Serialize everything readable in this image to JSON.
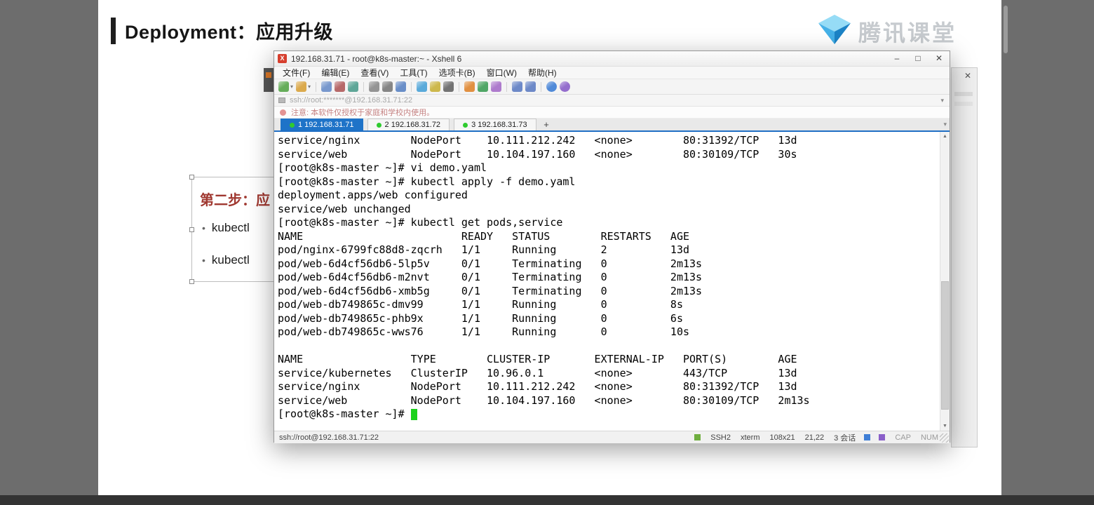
{
  "page": {
    "title": "Deployment：应用升级",
    "brand_name": "腾讯课堂"
  },
  "slide": {
    "heading": "第二步：应",
    "bullets": [
      "kubectl",
      "kubectl"
    ]
  },
  "xshell": {
    "window_title": "192.168.31.71 - root@k8s-master:~ - Xshell 6",
    "window_buttons": {
      "minimize": "–",
      "maximize": "□",
      "close": "✕"
    },
    "menus": [
      "文件(F)",
      "编辑(E)",
      "查看(V)",
      "工具(T)",
      "选项卡(B)",
      "窗口(W)",
      "帮助(H)"
    ],
    "toolbar_icons": [
      "new-session",
      "open-folder",
      "session-manager",
      "disconnect",
      "reconnect",
      "duplicate-session",
      "session-properties",
      "find",
      "compose-bar",
      "highlight-set",
      "font",
      "lock-screen",
      "file-transfer",
      "zmodem-upload",
      "tile-horizontal",
      "tile-vertical",
      "help",
      "about"
    ],
    "address_bar": {
      "value": "ssh://root:*******@192.168.31.71:22"
    },
    "notice": "注意: 本软件仅授权于家庭和学校内使用。",
    "tabs": [
      {
        "label": "1 192.168.31.71",
        "active": true
      },
      {
        "label": "2 192.168.31.72",
        "active": false
      },
      {
        "label": "3 192.168.31.73",
        "active": false
      }
    ],
    "new_tab_label": "+",
    "terminal": {
      "lines": [
        "service/nginx        NodePort    10.111.212.242   <none>        80:31392/TCP   13d",
        "service/web          NodePort    10.104.197.160   <none>        80:30109/TCP   30s",
        "[root@k8s-master ~]# vi demo.yaml",
        "[root@k8s-master ~]# kubectl apply -f demo.yaml",
        "deployment.apps/web configured",
        "service/web unchanged",
        "[root@k8s-master ~]# kubectl get pods,service",
        "NAME                         READY   STATUS        RESTARTS   AGE",
        "pod/nginx-6799fc88d8-zqcrh   1/1     Running       2          13d",
        "pod/web-6d4cf56db6-5lp5v     0/1     Terminating   0          2m13s",
        "pod/web-6d4cf56db6-m2nvt     0/1     Terminating   0          2m13s",
        "pod/web-6d4cf56db6-xmb5g     0/1     Terminating   0          2m13s",
        "pod/web-db749865c-dmv99      1/1     Running       0          8s",
        "pod/web-db749865c-phb9x      1/1     Running       0          6s",
        "pod/web-db749865c-wws76      1/1     Running       0          10s",
        "",
        "NAME                 TYPE        CLUSTER-IP       EXTERNAL-IP   PORT(S)        AGE",
        "service/kubernetes   ClusterIP   10.96.0.1        <none>        443/TCP        13d",
        "service/nginx        NodePort    10.111.212.242   <none>        80:31392/TCP   13d",
        "service/web          NodePort    10.104.197.160   <none>        80:30109/TCP   2m13s"
      ],
      "prompt_line": "[root@k8s-master ~]# "
    },
    "status_bar": {
      "left": "ssh://root@192.168.31.71:22",
      "protocol": "SSH2",
      "terminal_type": "xterm",
      "size": "108x21",
      "cursor_pos": "21,22",
      "sessions": "3 会话",
      "caps": "CAP",
      "num": "NUM"
    }
  },
  "colors": {
    "accent_blue": "#1f6fc4",
    "connected_green": "#2fcb2f",
    "cursor_green": "#1bd21b",
    "slide_heading_red": "#a03830"
  }
}
